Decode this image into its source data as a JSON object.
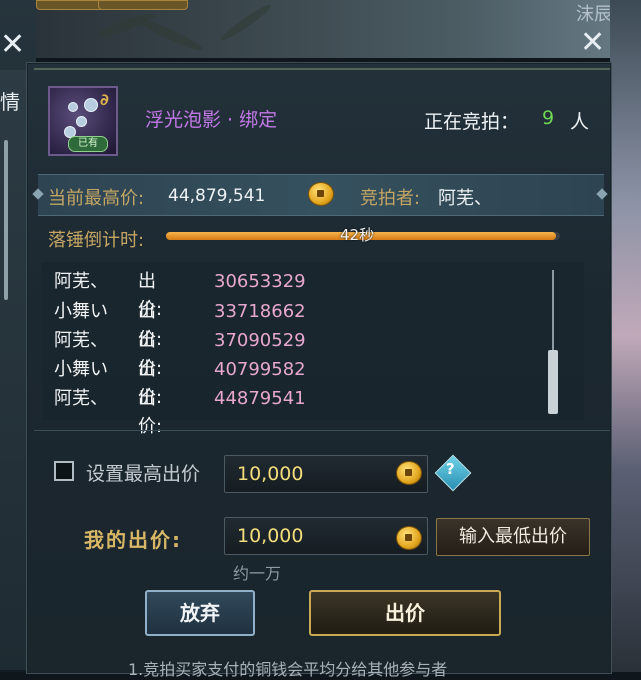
{
  "background": {
    "left_panel_char": "情",
    "top_name": "沫辰"
  },
  "item": {
    "name": "浮光泡影 · 绑定",
    "bound_tag": "已有",
    "icon": "bubbles-icon"
  },
  "bidding": {
    "label": "正在竞拍：",
    "count": "9",
    "unit": "人"
  },
  "current": {
    "price_label": "当前最高价:",
    "price_value": "44,879,541",
    "bidder_label": "竞拍者:",
    "bidder_value": "阿芜、"
  },
  "countdown": {
    "label": "落锤倒计时:",
    "text": "42秒",
    "progress": 0.99
  },
  "bid_log": [
    {
      "name": "阿芜、",
      "label": "出价:",
      "amount": "30653329"
    },
    {
      "name": "小舞い",
      "label": "出价:",
      "amount": "33718662"
    },
    {
      "name": "阿芜、",
      "label": "出价:",
      "amount": "37090529"
    },
    {
      "name": "小舞い",
      "label": "出价:",
      "amount": "40799582"
    },
    {
      "name": "阿芜、",
      "label": "出价:",
      "amount": "44879541"
    }
  ],
  "max_bid": {
    "label": "设置最高出价",
    "value": "10,000",
    "checked": false
  },
  "my_bid": {
    "label": "我的出价:",
    "value": "10,000",
    "approx": "约一万",
    "min_button": "输入最低出价"
  },
  "buttons": {
    "give_up": "放弃",
    "bid": "出价"
  },
  "footer": "1.竞拍买家支付的铜钱会平均分给其他参与者",
  "colors": {
    "item_name": "#c278e6",
    "bid_count": "#6fd854",
    "bid_amount": "#e7a7cf",
    "label_gold": "#c4a563"
  }
}
